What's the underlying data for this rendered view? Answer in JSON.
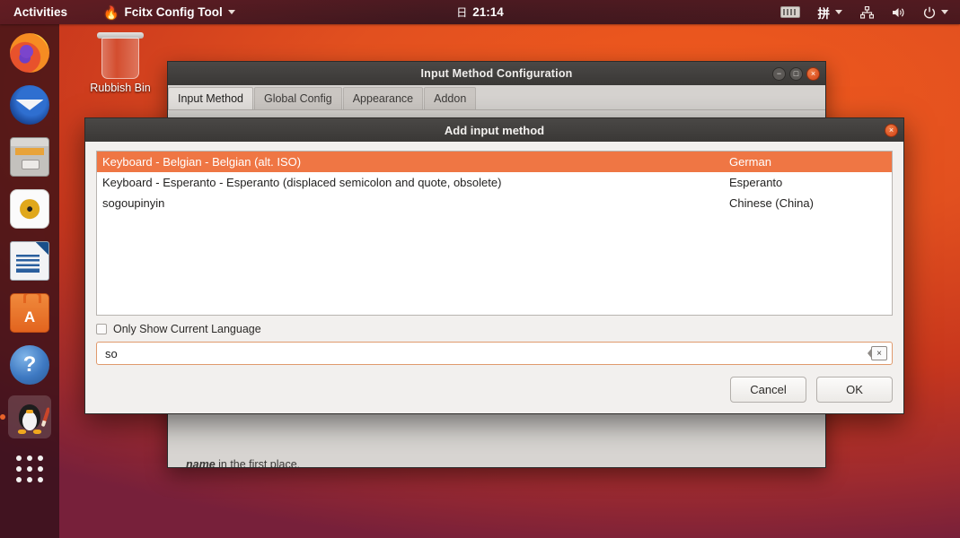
{
  "topbar": {
    "activities": "Activities",
    "app_name": "Fcitx Config Tool",
    "app_icon": "fcitx-flame-icon",
    "clock": "21:14",
    "calendar_icon": "日",
    "keyboard_icon": "keyboard-indicator-icon",
    "input_method_label": "拼",
    "network_icon": "network-icon",
    "volume_icon": "volume-icon",
    "power_icon": "power-icon"
  },
  "dock": {
    "items": [
      {
        "name": "firefox",
        "icon": "firefox-icon"
      },
      {
        "name": "thunderbird",
        "icon": "thunderbird-icon"
      },
      {
        "name": "files",
        "icon": "files-icon"
      },
      {
        "name": "rhythmbox",
        "icon": "rhythmbox-icon"
      },
      {
        "name": "libreoffice-writer",
        "icon": "libreoffice-writer-icon"
      },
      {
        "name": "ubuntu-software",
        "icon": "ubuntu-software-icon"
      },
      {
        "name": "help",
        "icon": "help-icon"
      },
      {
        "name": "fcitx",
        "icon": "penguin-icon"
      },
      {
        "name": "show-applications",
        "icon": "app-grid-icon"
      }
    ]
  },
  "desktop": {
    "rubbish_bin_label": "Rubbish Bin"
  },
  "main_window": {
    "title": "Input Method Configuration",
    "minimize_glyph": "−",
    "maximize_glyph": "□",
    "close_glyph": "×",
    "tabs": [
      {
        "label": "Input Method",
        "active": true
      },
      {
        "label": "Global Config",
        "active": false
      },
      {
        "label": "Appearance",
        "active": false
      },
      {
        "label": "Addon",
        "active": false
      }
    ],
    "body_text_italic": "name",
    "body_text_rest": " in the first place.",
    "toolbar": [
      {
        "name": "add-input-method-button",
        "glyph": "+",
        "disabled": false
      },
      {
        "name": "remove-input-method-button",
        "glyph": "−",
        "disabled": false
      },
      {
        "name": "move-up-button",
        "glyph": "∧",
        "disabled": true
      },
      {
        "name": "move-down-button",
        "glyph": "∨",
        "disabled": true
      },
      {
        "name": "configure-button",
        "glyph": "",
        "disabled": false
      },
      {
        "name": "keyboard-layout-button",
        "glyph": "",
        "disabled": false
      }
    ]
  },
  "dialog": {
    "title": "Add input method",
    "close_glyph": "×",
    "input_methods": [
      {
        "name": "Keyboard - Belgian - Belgian (alt. ISO)",
        "language": "German",
        "selected": true
      },
      {
        "name": "Keyboard - Esperanto - Esperanto (displaced semicolon and quote, obsolete)",
        "language": "Esperanto",
        "selected": false
      },
      {
        "name": "sogoupinyin",
        "language": "Chinese (China)",
        "selected": false
      }
    ],
    "only_current_language_label": "Only Show Current Language",
    "only_current_language_checked": false,
    "search_value": "so",
    "search_placeholder": "",
    "clear_glyph": "×",
    "cancel_label": "Cancel",
    "ok_label": "OK"
  },
  "colors": {
    "selection": "#ef7644",
    "accent": "#e2501f",
    "titlebar": "#3a3836"
  }
}
